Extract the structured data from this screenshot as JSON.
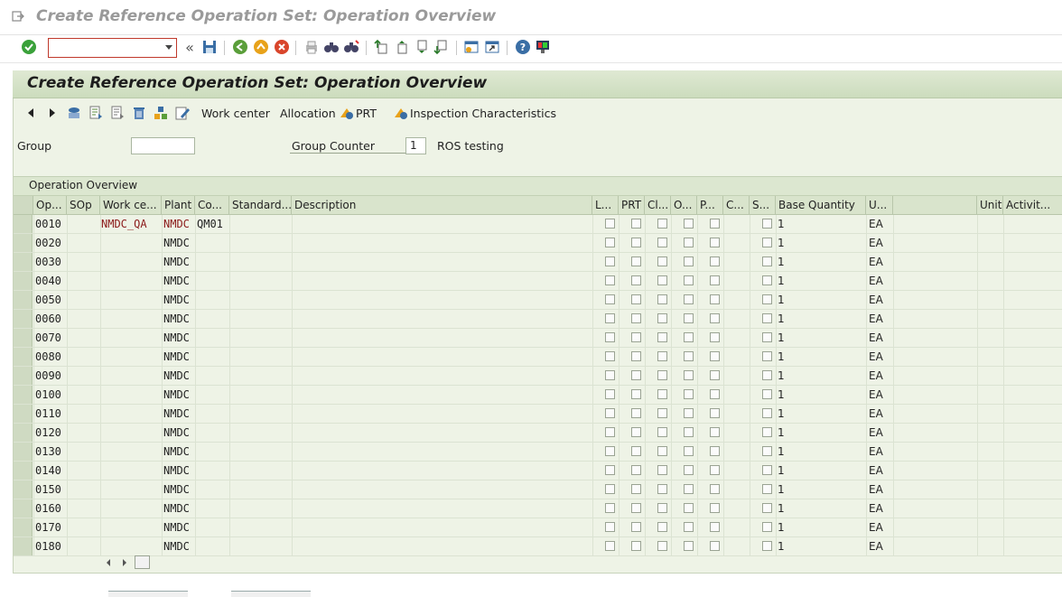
{
  "window": {
    "title": "Create Reference Operation Set: Operation Overview"
  },
  "toolbar": {
    "command_value": ""
  },
  "screen": {
    "title": "Create Reference Operation Set: Operation Overview",
    "buttons": {
      "work_center": "Work center",
      "allocation": "Allocation",
      "prt": "PRT",
      "inspection": "Inspection Characteristics"
    }
  },
  "header_fields": {
    "group_label": "Group",
    "group_value": "",
    "group_counter_label": "Group Counter",
    "group_counter_value": "1",
    "group_desc": "ROS testing"
  },
  "section": {
    "title": "Operation Overview"
  },
  "table": {
    "columns": {
      "op": "Op...",
      "sop": "SOp",
      "wc": "Work ce...",
      "plant": "Plant",
      "co": "Co...",
      "std": "Standard...",
      "desc": "Description",
      "l": "L...",
      "prt": "PRT",
      "cl": "Cl...",
      "o": "O...",
      "p": "P...",
      "c": "C...",
      "s": "S...",
      "base": "Base Quantity",
      "u": "U...",
      "blank": "",
      "unit": "Unit",
      "activ": "Activit..."
    },
    "rows": [
      {
        "op": "0010",
        "wc": "NMDC_QA",
        "plant": "NMDC",
        "co": "QM01",
        "base": "1",
        "u": "EA"
      },
      {
        "op": "0020",
        "wc": "",
        "plant": "NMDC",
        "co": "",
        "base": "1",
        "u": "EA"
      },
      {
        "op": "0030",
        "wc": "",
        "plant": "NMDC",
        "co": "",
        "base": "1",
        "u": "EA"
      },
      {
        "op": "0040",
        "wc": "",
        "plant": "NMDC",
        "co": "",
        "base": "1",
        "u": "EA"
      },
      {
        "op": "0050",
        "wc": "",
        "plant": "NMDC",
        "co": "",
        "base": "1",
        "u": "EA"
      },
      {
        "op": "0060",
        "wc": "",
        "plant": "NMDC",
        "co": "",
        "base": "1",
        "u": "EA"
      },
      {
        "op": "0070",
        "wc": "",
        "plant": "NMDC",
        "co": "",
        "base": "1",
        "u": "EA"
      },
      {
        "op": "0080",
        "wc": "",
        "plant": "NMDC",
        "co": "",
        "base": "1",
        "u": "EA"
      },
      {
        "op": "0090",
        "wc": "",
        "plant": "NMDC",
        "co": "",
        "base": "1",
        "u": "EA"
      },
      {
        "op": "0100",
        "wc": "",
        "plant": "NMDC",
        "co": "",
        "base": "1",
        "u": "EA"
      },
      {
        "op": "0110",
        "wc": "",
        "plant": "NMDC",
        "co": "",
        "base": "1",
        "u": "EA"
      },
      {
        "op": "0120",
        "wc": "",
        "plant": "NMDC",
        "co": "",
        "base": "1",
        "u": "EA"
      },
      {
        "op": "0130",
        "wc": "",
        "plant": "NMDC",
        "co": "",
        "base": "1",
        "u": "EA"
      },
      {
        "op": "0140",
        "wc": "",
        "plant": "NMDC",
        "co": "",
        "base": "1",
        "u": "EA"
      },
      {
        "op": "0150",
        "wc": "",
        "plant": "NMDC",
        "co": "",
        "base": "1",
        "u": "EA"
      },
      {
        "op": "0160",
        "wc": "",
        "plant": "NMDC",
        "co": "",
        "base": "1",
        "u": "EA"
      },
      {
        "op": "0170",
        "wc": "",
        "plant": "NMDC",
        "co": "",
        "base": "1",
        "u": "EA"
      },
      {
        "op": "0180",
        "wc": "",
        "plant": "NMDC",
        "co": "",
        "base": "1",
        "u": "EA"
      }
    ]
  },
  "colors": {
    "panel_bg": "#eef3e6",
    "header_bg": "#d9e4cc",
    "accent_red": "#8b1a1a"
  }
}
